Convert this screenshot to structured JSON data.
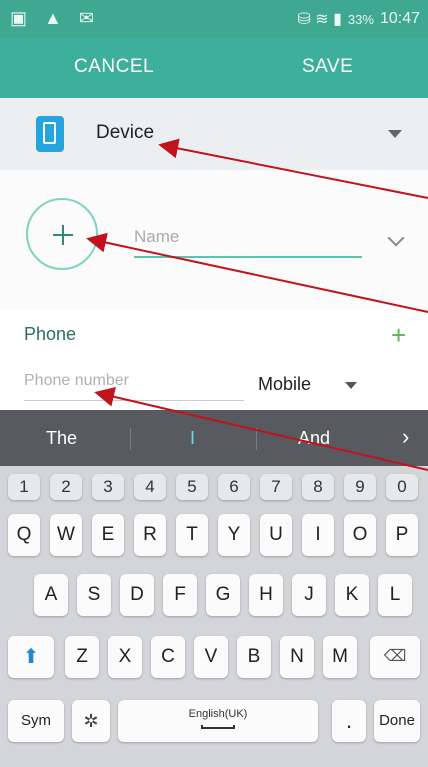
{
  "status": {
    "left_icons": "▣ ▲ ✉",
    "right_icons": "⛁ ≋ ▮",
    "battery": "33%",
    "time": "10:47"
  },
  "actionbar": {
    "cancel": "CANCEL",
    "save": "SAVE"
  },
  "device": {
    "label": "Device"
  },
  "name_field": {
    "placeholder": "Name"
  },
  "phone": {
    "title": "Phone",
    "add": "+",
    "placeholder": "Phone number",
    "type": "Mobile"
  },
  "keyboard": {
    "suggestions": [
      "The",
      "I",
      "And"
    ],
    "suggest_more": "›",
    "numbers": [
      "1",
      "2",
      "3",
      "4",
      "5",
      "6",
      "7",
      "8",
      "9",
      "0"
    ],
    "row1": [
      "Q",
      "W",
      "E",
      "R",
      "T",
      "Y",
      "U",
      "I",
      "O",
      "P"
    ],
    "row2": [
      "A",
      "S",
      "D",
      "F",
      "G",
      "H",
      "J",
      "K",
      "L"
    ],
    "row3": [
      "Z",
      "X",
      "C",
      "V",
      "B",
      "N",
      "M"
    ],
    "sym": "Sym",
    "space_label": "English(UK)",
    "period": ".",
    "done": "Done"
  },
  "colors": {
    "accent": "#3cb09a",
    "shift_arrow": "#1e88d2",
    "device_icon": "#25a4dd",
    "add_plus": "#57b94f"
  }
}
